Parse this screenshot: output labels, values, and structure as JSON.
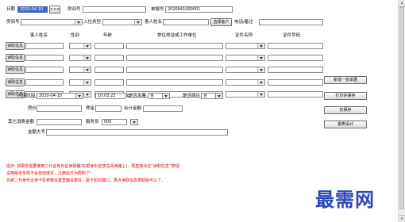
{
  "header": {
    "date_label": "日期",
    "date_value": "2020-04-10",
    "nav_button": ">>>",
    "room_label": "房间号",
    "bill_no_label": "单据号",
    "bill_no_value": "2020041000001"
  },
  "row2": {
    "room_type_label": "房间号",
    "checkin_type_label": "入住类型",
    "guest_label": "客人姓名",
    "select_guest_button": "选择客户",
    "phone_label": "电话/备注"
  },
  "guest_table": {
    "columns": [
      "客人姓名",
      "性别",
      "年龄",
      "常住地址或工作单位",
      "证件名称",
      "证件号码"
    ],
    "read_button": "读取信息",
    "rows": 5
  },
  "details": {
    "checkin_time_label": "入住时间",
    "checkin_date": "2020-04-10",
    "checkin_time": "10:03:22",
    "room_fee_label": "是否发票",
    "room_fee_value": "否",
    "invoice_label": "是否续住",
    "invoice_value": "否",
    "price_label": "房价",
    "deposit_label": "押金",
    "total_deposit_label": "合计金额",
    "other_amount_label": "其它消费金额",
    "staff_label": "服务员",
    "staff_value": "005",
    "amount_words_label": "金额大写"
  },
  "actions": {
    "new_bill": "新增一张单据",
    "print_save": "打印并保存",
    "save_only": "仅保存",
    "report_design": "报表设计"
  },
  "tips": [
    "提示: 如果你需要使用二代证身份证读取器(先把身份证放在阅读器上)，再直接点击“读取信息”按钮!",
    "试用版本年限不会自动填写，注册后方为限制了!",
    "先到二代身份证读卡机参数设置里面设置好，驱卡机的端口，再点读取信息按钮就可以了。"
  ],
  "watermark": "最需网"
}
